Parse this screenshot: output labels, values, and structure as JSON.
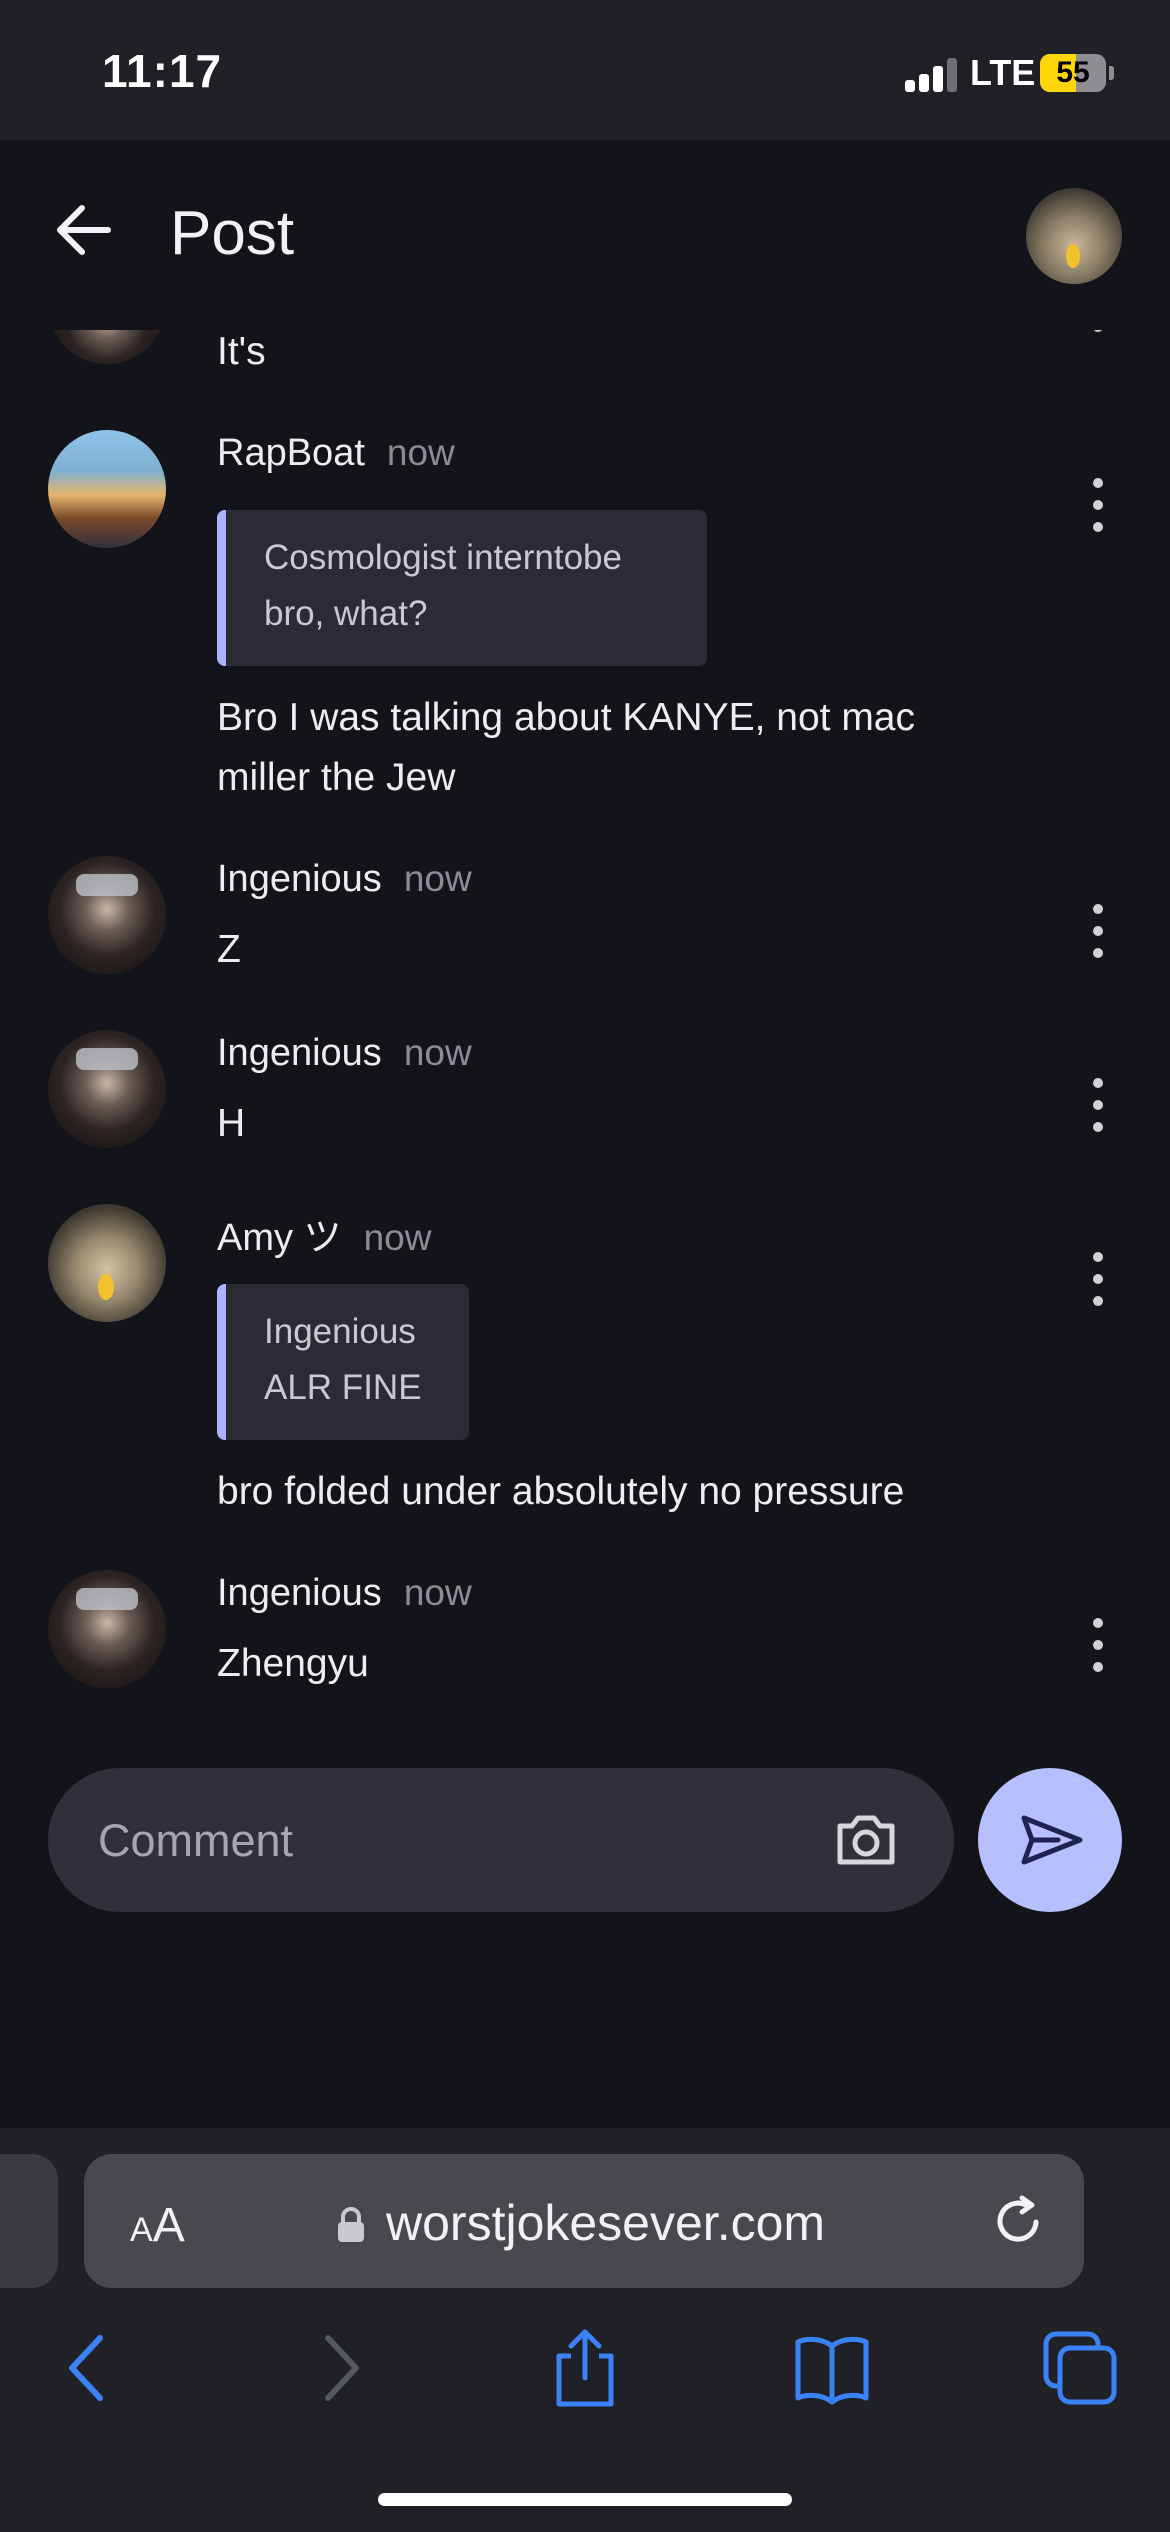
{
  "status_bar": {
    "time": "11:17",
    "network": "LTE",
    "battery_level": "55",
    "battery_fraction": 0.55
  },
  "header": {
    "title": "Post"
  },
  "comments": [
    {
      "author": "",
      "time": "",
      "text": "It's",
      "avatar": "ninja",
      "partial": true
    },
    {
      "author": "RapBoat",
      "time": "now",
      "quote_author": "Cosmologist interntobe",
      "quote_text": "bro, what?",
      "text_lines": [
        "Bro I was talking about KANYE, not mac",
        "miller the Jew"
      ],
      "avatar": "rap"
    },
    {
      "author": "Ingenious",
      "time": "now",
      "text": "Z",
      "avatar": "ninja"
    },
    {
      "author": "Ingenious",
      "time": "now",
      "text": "H",
      "avatar": "ninja"
    },
    {
      "author": "Amy ツ",
      "time": "now",
      "quote_author": "Ingenious",
      "quote_text": "ALR FINE",
      "text": "bro folded under absolutely no pressure",
      "avatar": "cat"
    },
    {
      "author": "Ingenious",
      "time": "now",
      "text": "Zhengyu",
      "avatar": "ninja"
    }
  ],
  "composer": {
    "placeholder": "Comment",
    "value": ""
  },
  "browser": {
    "text_size_label_small": "A",
    "text_size_label_large": "A",
    "url": "worstjokesever.com"
  },
  "colors": {
    "background": "#13141a",
    "accent": "#b7c0ff",
    "quote_border": "#aab3ff",
    "browser_icons": "#3b82f6"
  },
  "icons": [
    "arrow-left-icon",
    "more-vertical-icon",
    "camera-icon",
    "send-icon",
    "lock-icon",
    "reload-icon",
    "back-chevron-icon",
    "forward-chevron-icon",
    "share-icon",
    "bookmarks-icon",
    "tabs-icon"
  ]
}
